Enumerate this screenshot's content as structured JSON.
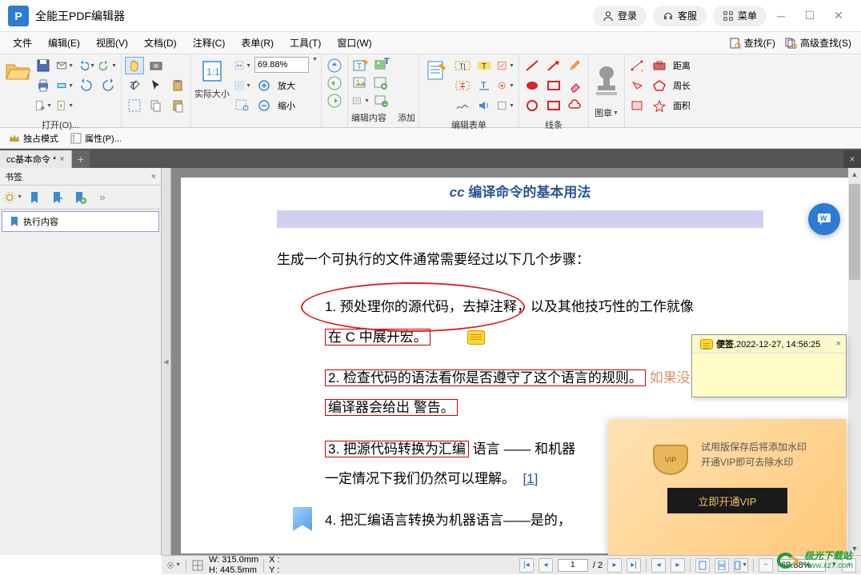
{
  "app": {
    "title": "全能王PDF编辑器"
  },
  "titlebar": {
    "login": "登录",
    "service": "客服",
    "menu": "菜单"
  },
  "menubar": {
    "items": [
      "文件",
      "编辑(E)",
      "视图(V)",
      "文档(D)",
      "注释(C)",
      "表单(R)",
      "工具(T)",
      "窗口(W)"
    ],
    "find": "查找(F)",
    "advfind": "高级查找(S)"
  },
  "ribbon": {
    "open": "打开(O)...",
    "actual": "实际大小",
    "zoomin": "放大",
    "zoomout": "缩小",
    "zoom_value": "69.88%",
    "edit_content": "编辑内容",
    "add": "添加",
    "edit_form": "编辑表单",
    "lines": "线条",
    "stamp": "图章",
    "distance": "距离",
    "perimeter": "周长",
    "area": "面积"
  },
  "subbar": {
    "exclusive": "独占模式",
    "props": "属性(P)..."
  },
  "tab": {
    "name": "cc基本命令 *"
  },
  "sidebar": {
    "title": "书签",
    "bookmark": "执行内容"
  },
  "document": {
    "heading_partial": "编译命令的基本用法",
    "heading_prefix": "cc",
    "intro": "生成一个可执行的文件通常需要经过以下几个步骤：",
    "item1a": "1. 预处理你的源代码，去掉注释，以及其他技巧性的工作就像",
    "item1b": "在 C 中展开宏。",
    "item2a": "2. 检查代码的语法看你是否遵守了这个语言的规则。",
    "item2a_tail": "如果没有，",
    "item2b": "编译器会给出 警告。",
    "item3a": "3. 把源代码转换为汇编",
    "item3a_mid": "语言 —— 和机器",
    "item3b": "一定情况下我们仍然可以理解。",
    "item3b_ref": "[1]",
    "item4": "4. 把汇编语言转换为机器语言——是的，"
  },
  "note": {
    "label": "便签",
    "timestamp": ",2022-12-27, 14:56:25"
  },
  "vip": {
    "line1": "试用版保存后将添加水印",
    "line2": "开通VIP即可去除水印",
    "button": "立即开通VIP"
  },
  "status": {
    "w": "W: 315.0mm",
    "h": "H: 445.5mm",
    "x": "X :",
    "y": "Y :",
    "page_cur": "1",
    "page_total": "/ 2",
    "zoom": "69.88%"
  },
  "watermark": {
    "brand": "极光下载站",
    "url": "www.xz7.com"
  }
}
